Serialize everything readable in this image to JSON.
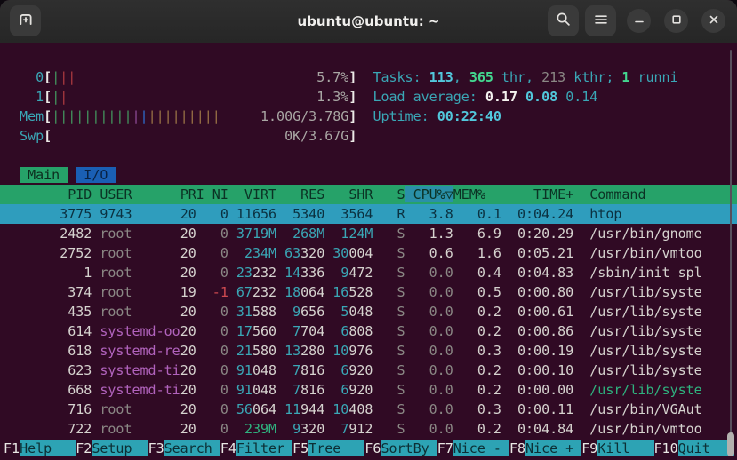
{
  "window": {
    "title": "ubuntu@ubuntu: ~"
  },
  "colors": {
    "terminal_background": "#300a24",
    "header_green": "#26a269",
    "selection_cyan": "#2f9dbd",
    "sort_column_highlight": "#2a90a8",
    "tab_blue": "#1a5fb4",
    "function_label_cyan": "#2da3b4"
  },
  "meters": [
    {
      "label": "0",
      "value": "5.7%",
      "bars": [
        [
          "green",
          1
        ],
        [
          "red",
          2
        ]
      ]
    },
    {
      "label": "1",
      "value": "1.3%",
      "bars": [
        [
          "green",
          1
        ],
        [
          "red",
          1
        ]
      ]
    },
    {
      "label": "Mem",
      "value": "1.00G/3.78G",
      "bars": [
        [
          "green",
          10
        ],
        [
          "magenta",
          1
        ],
        [
          "blue",
          1
        ],
        [
          "tan",
          9
        ]
      ]
    },
    {
      "label": "Swp",
      "value": "0K/3.67G",
      "bars": []
    }
  ],
  "summary": {
    "lines": [
      {
        "name": "tasks-summary",
        "segments": [
          [
            "Tasks: ",
            "cyan"
          ],
          [
            "113",
            "bright_cyan"
          ],
          [
            ", ",
            "cyan"
          ],
          [
            "365",
            "bold_green"
          ],
          [
            " thr, ",
            "cyan"
          ],
          [
            "213",
            "dim"
          ],
          [
            " kthr; ",
            "cyan"
          ],
          [
            "1",
            "bold_green"
          ],
          [
            " runni",
            "cyan"
          ]
        ]
      },
      {
        "name": "load-average",
        "segments": [
          [
            "Load average: ",
            "cyan"
          ],
          [
            "0.17 ",
            "bold_white"
          ],
          [
            "0.08 ",
            "bright_cyan"
          ],
          [
            "0.14",
            "cyan"
          ]
        ]
      },
      {
        "name": "uptime",
        "segments": [
          [
            "Uptime: ",
            "cyan"
          ],
          [
            "00:22:40",
            "bright_cyan"
          ]
        ]
      }
    ]
  },
  "tabs": [
    {
      "label": "Main",
      "active": true
    },
    {
      "label": "I/O",
      "active": false
    }
  ],
  "table": {
    "columns": [
      {
        "label": "PID"
      },
      {
        "label": "USER"
      },
      {
        "label": "PRI"
      },
      {
        "label": "NI"
      },
      {
        "label": "VIRT"
      },
      {
        "label": "RES"
      },
      {
        "label": "SHR"
      },
      {
        "label": "S"
      },
      {
        "label": "CPU%",
        "sorted": true,
        "sort_icon": "▽"
      },
      {
        "label": "MEM%"
      },
      {
        "label": "TIME+"
      },
      {
        "label": "Command"
      }
    ],
    "rows": [
      {
        "pid": "3775",
        "user": "9743",
        "pri": "20",
        "ni": "0",
        "virt": "11656",
        "res": "5340",
        "shr": "3564",
        "s": "R",
        "cpu": "3.8",
        "mem": "0.1",
        "time": "0:04.24",
        "cmd": "htop",
        "selected": true
      },
      {
        "pid": "2482",
        "user": "root",
        "pri": "20",
        "ni": "0",
        "virt": "3719M",
        "res": "268M",
        "shr": "124M",
        "s": "S",
        "cpu": "1.3",
        "mem": "6.9",
        "time": "0:20.29",
        "cmd": "/usr/bin/gnome"
      },
      {
        "pid": "2752",
        "user": "root",
        "pri": "20",
        "ni": "0",
        "virt": "234M",
        "res": "63320",
        "shr": "30004",
        "s": "S",
        "cpu": "0.6",
        "mem": "1.6",
        "time": "0:05.21",
        "cmd": "/usr/bin/vmtoo"
      },
      {
        "pid": "1",
        "user": "root",
        "pri": "20",
        "ni": "0",
        "virt": "23232",
        "res": "14336",
        "shr": "9472",
        "s": "S",
        "cpu": "0.0",
        "mem": "0.4",
        "time": "0:04.83",
        "cmd": "/sbin/init spl"
      },
      {
        "pid": "374",
        "user": "root",
        "pri": "19",
        "ni": "-1",
        "virt": "67232",
        "res": "18064",
        "shr": "16528",
        "s": "S",
        "cpu": "0.0",
        "mem": "0.5",
        "time": "0:00.80",
        "cmd": "/usr/lib/syste"
      },
      {
        "pid": "435",
        "user": "root",
        "pri": "20",
        "ni": "0",
        "virt": "31588",
        "res": "9656",
        "shr": "5048",
        "s": "S",
        "cpu": "0.0",
        "mem": "0.2",
        "time": "0:00.61",
        "cmd": "/usr/lib/syste"
      },
      {
        "pid": "614",
        "user": "systemd-oo",
        "pri": "20",
        "ni": "0",
        "virt": "17560",
        "res": "7704",
        "shr": "6808",
        "s": "S",
        "cpu": "0.0",
        "mem": "0.2",
        "time": "0:00.86",
        "cmd": "/usr/lib/syste"
      },
      {
        "pid": "618",
        "user": "systemd-re",
        "pri": "20",
        "ni": "0",
        "virt": "21580",
        "res": "13280",
        "shr": "10976",
        "s": "S",
        "cpu": "0.0",
        "mem": "0.3",
        "time": "0:00.19",
        "cmd": "/usr/lib/syste"
      },
      {
        "pid": "623",
        "user": "systemd-ti",
        "pri": "20",
        "ni": "0",
        "virt": "91048",
        "res": "7816",
        "shr": "6920",
        "s": "S",
        "cpu": "0.0",
        "mem": "0.2",
        "time": "0:00.10",
        "cmd": "/usr/lib/syste"
      },
      {
        "pid": "668",
        "user": "systemd-ti",
        "pri": "20",
        "ni": "0",
        "virt": "91048",
        "res": "7816",
        "shr": "6920",
        "s": "S",
        "cpu": "0.0",
        "mem": "0.2",
        "time": "0:00.00",
        "cmd": "/usr/lib/syste",
        "cmd_color": "green"
      },
      {
        "pid": "716",
        "user": "root",
        "pri": "20",
        "ni": "0",
        "virt": "56064",
        "res": "11944",
        "shr": "10408",
        "s": "S",
        "cpu": "0.0",
        "mem": "0.3",
        "time": "0:00.11",
        "cmd": "/usr/bin/VGAut"
      },
      {
        "pid": "722",
        "user": "root",
        "pri": "20",
        "ni": "0",
        "virt": "239M",
        "res": "9320",
        "shr": "7912",
        "s": "S",
        "cpu": "0.0",
        "mem": "0.2",
        "time": "0:04.84",
        "cmd": "/usr/bin/vmtoo",
        "virt_color": "green"
      }
    ]
  },
  "function_keys": [
    {
      "key": "F1",
      "label": "Help"
    },
    {
      "key": "F2",
      "label": "Setup"
    },
    {
      "key": "F3",
      "label": "Search"
    },
    {
      "key": "F4",
      "label": "Filter"
    },
    {
      "key": "F5",
      "label": "Tree"
    },
    {
      "key": "F6",
      "label": "SortBy"
    },
    {
      "key": "F7",
      "label": "Nice -"
    },
    {
      "key": "F8",
      "label": "Nice +"
    },
    {
      "key": "F9",
      "label": "Kill"
    },
    {
      "key": "F10",
      "label": "Quit"
    }
  ]
}
